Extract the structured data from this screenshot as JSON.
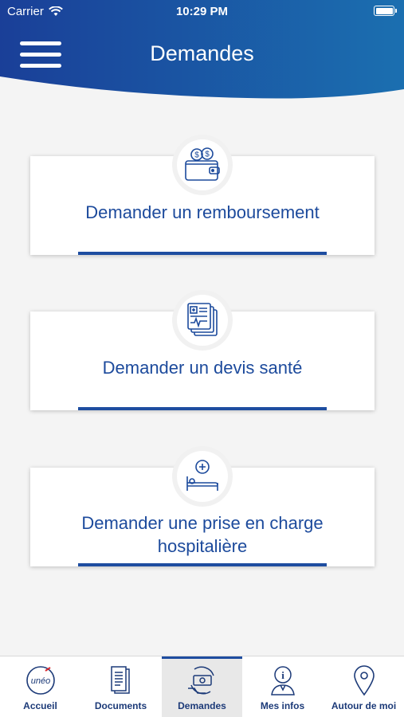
{
  "status_bar": {
    "carrier": "Carrier",
    "time": "10:29 PM"
  },
  "header": {
    "title": "Demandes",
    "menu_icon": "hamburger-menu-icon"
  },
  "cards": [
    {
      "label": "Demander un remboursement",
      "icon": "wallet-coins-icon"
    },
    {
      "label": "Demander un devis santé",
      "icon": "medical-documents-icon"
    },
    {
      "label_line1": "Demander une prise en charge",
      "label_line2": "hospitalière",
      "icon": "hospital-bed-icon"
    }
  ],
  "tabbar": {
    "active": "Demandes",
    "tabs": [
      {
        "label": "Accueil",
        "icon": "uneo-logo-icon"
      },
      {
        "label": "Documents",
        "icon": "document-icon"
      },
      {
        "label": "Demandes",
        "icon": "requests-money-icon"
      },
      {
        "label": "Mes infos",
        "icon": "user-info-icon"
      },
      {
        "label": "Autour de moi",
        "icon": "location-pin-icon"
      }
    ]
  },
  "colors": {
    "header_start": "#1a3f98",
    "header_end": "#1b6fb0",
    "accent": "#1e4da0",
    "text": "#1c4a9c"
  }
}
